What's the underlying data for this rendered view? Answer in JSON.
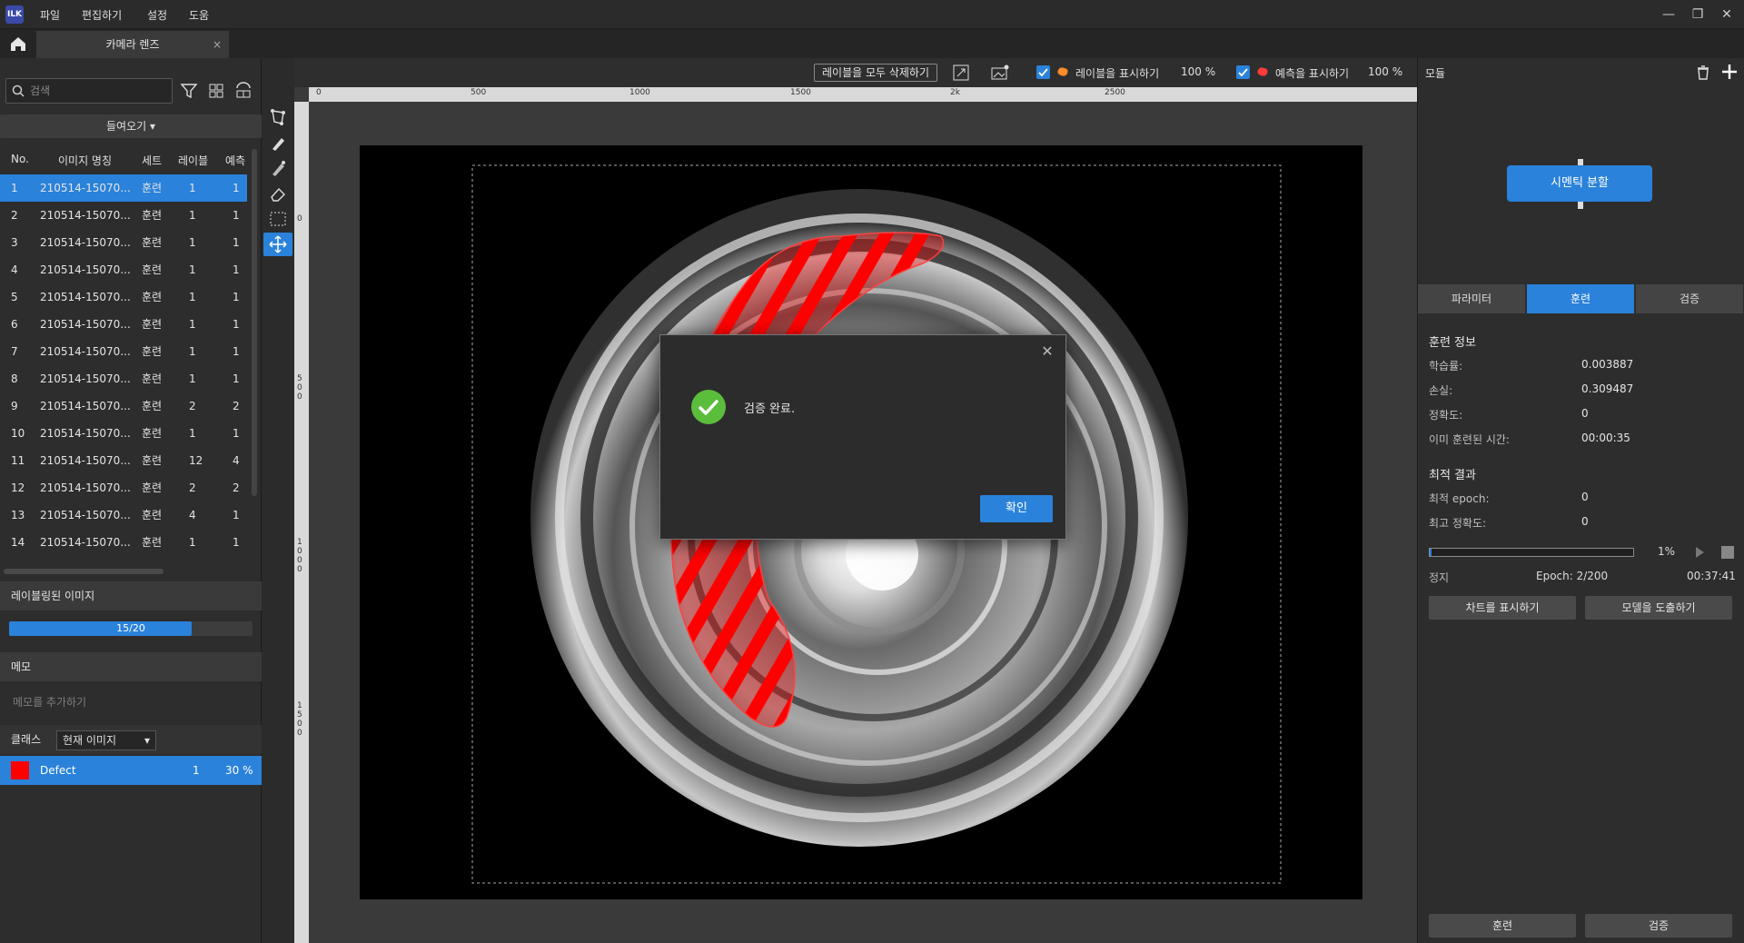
{
  "app": {
    "logo_text": "ILK",
    "menu": [
      "파일",
      "편집하기",
      "설정",
      "도움"
    ],
    "window_controls": [
      "—",
      "❐",
      "✕"
    ]
  },
  "tabs": [
    {
      "label": "카메라 렌즈",
      "close": "×"
    }
  ],
  "left": {
    "search_placeholder": "검색",
    "import_label": "들여오기 ▾",
    "columns": [
      "No.",
      "이미지 명칭",
      "세트",
      "레이블",
      "예측"
    ],
    "rows": [
      {
        "no": "1",
        "name": "210514-15070...",
        "set": "훈련",
        "label": "1",
        "pred": "1"
      },
      {
        "no": "2",
        "name": "210514-15070...",
        "set": "훈련",
        "label": "1",
        "pred": "1"
      },
      {
        "no": "3",
        "name": "210514-15070...",
        "set": "훈련",
        "label": "1",
        "pred": "1"
      },
      {
        "no": "4",
        "name": "210514-15070...",
        "set": "훈련",
        "label": "1",
        "pred": "1"
      },
      {
        "no": "5",
        "name": "210514-15070...",
        "set": "훈련",
        "label": "1",
        "pred": "1"
      },
      {
        "no": "6",
        "name": "210514-15070...",
        "set": "훈련",
        "label": "1",
        "pred": "1"
      },
      {
        "no": "7",
        "name": "210514-15070...",
        "set": "훈련",
        "label": "1",
        "pred": "1"
      },
      {
        "no": "8",
        "name": "210514-15070...",
        "set": "훈련",
        "label": "1",
        "pred": "1"
      },
      {
        "no": "9",
        "name": "210514-15070...",
        "set": "훈련",
        "label": "2",
        "pred": "2"
      },
      {
        "no": "10",
        "name": "210514-15070...",
        "set": "훈련",
        "label": "1",
        "pred": "1"
      },
      {
        "no": "11",
        "name": "210514-15070...",
        "set": "훈련",
        "label": "12",
        "pred": "4"
      },
      {
        "no": "12",
        "name": "210514-15070...",
        "set": "훈련",
        "label": "2",
        "pred": "2"
      },
      {
        "no": "13",
        "name": "210514-15070...",
        "set": "훈련",
        "label": "4",
        "pred": "1"
      },
      {
        "no": "14",
        "name": "210514-15070...",
        "set": "훈련",
        "label": "1",
        "pred": "1"
      }
    ],
    "labeled_title": "레이블링된 이미지",
    "labeled_progress_text": "15/20",
    "labeled_fraction": 0.75,
    "memo_title": "메모",
    "memo_placeholder": "메모를 추가하기",
    "class_label": "클래스",
    "class_select": "현재 이미지",
    "class_item": {
      "name": "Defect",
      "count": "1",
      "percent": "30 %",
      "color": "#ff0000"
    }
  },
  "toolbar": {
    "delete_all": "레이블을 모두 삭제하기",
    "show_labels": "레이블을 표시하기",
    "labels_opacity": "100 %",
    "show_pred": "예측을 표시하기",
    "pred_opacity": "100 %"
  },
  "ruler": {
    "top_ticks": [
      "0",
      "500",
      "1000",
      "1500",
      "2k",
      "2500"
    ],
    "left_ticks": [
      "0",
      "500",
      "1000",
      "1500"
    ]
  },
  "right": {
    "title": "모듈",
    "module_name": "시멘틱 분할",
    "tabs": [
      "파라미터",
      "훈련",
      "검증"
    ],
    "train_info_title": "훈련 정보",
    "info": [
      {
        "label": "학습률:",
        "value": "0.003887"
      },
      {
        "label": "손실:",
        "value": "0.309487"
      },
      {
        "label": "정확도:",
        "value": "0"
      },
      {
        "label": "이미 훈련된 시간:",
        "value": "00:00:35"
      }
    ],
    "best_title": "최적 결과",
    "best": [
      {
        "label": "최적 epoch:",
        "value": "0"
      },
      {
        "label": "최고 정확도:",
        "value": "0"
      }
    ],
    "progress_percent": "1%",
    "progress_fraction": 0.01,
    "status": "정지",
    "epoch": "Epoch: 2/200",
    "elapsed": "00:37:41",
    "show_chart": "차트를 표시하기",
    "export_model": "모델을 도출하기",
    "train_btn": "훈련",
    "validate_btn": "검증"
  },
  "dialog": {
    "message": "검증 완료.",
    "ok": "확인",
    "close": "✕"
  },
  "colors": {
    "accent": "#2a82da",
    "success": "#5bbd3c",
    "defect": "#ff0000"
  }
}
